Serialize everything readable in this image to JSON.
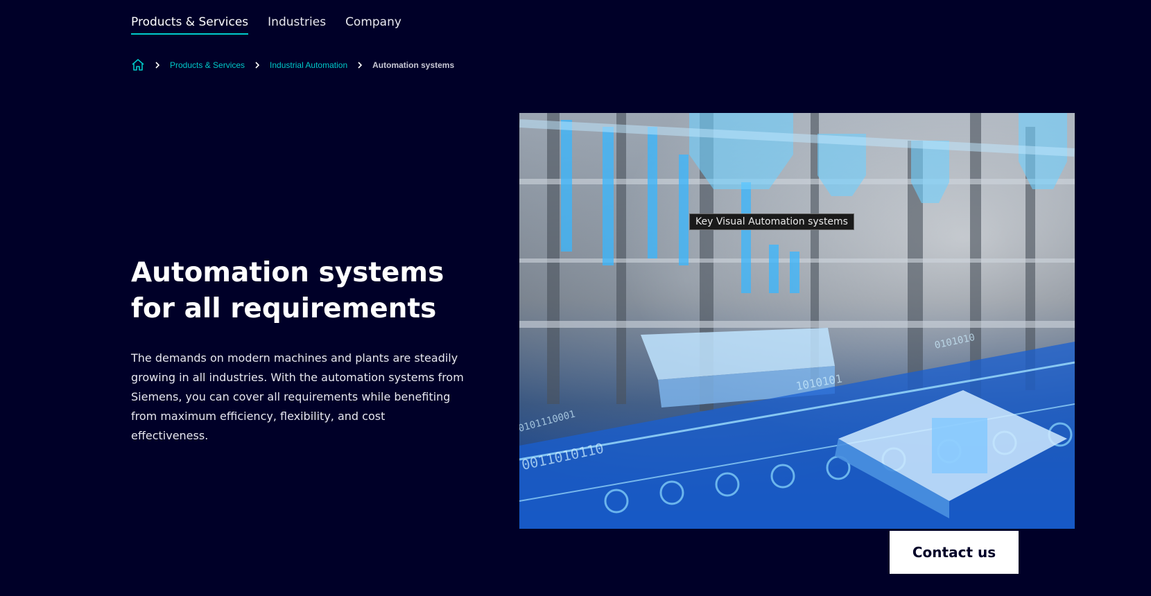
{
  "nav": {
    "items": [
      {
        "label": "Products & Services"
      },
      {
        "label": "Industries"
      },
      {
        "label": "Company"
      }
    ]
  },
  "breadcrumb": {
    "home_icon": "home-icon",
    "items": [
      {
        "label": "Products & Services"
      },
      {
        "label": "Industrial Automation"
      }
    ],
    "current": "Automation systems"
  },
  "hero": {
    "title": "Automation systems for all requirements",
    "description": "The demands on modern machines and plants are steadily growing in all industries. With the automation systems from Siemens, you can cover all requirements while benefiting from maximum efficiency, flexibility, and cost effectiveness.",
    "image_tooltip": "Key Visual Automation systems"
  },
  "cta": {
    "contact_label": "Contact us"
  },
  "colors": {
    "background": "#000028",
    "accent": "#00cccc",
    "button_bg": "#ffffff"
  }
}
